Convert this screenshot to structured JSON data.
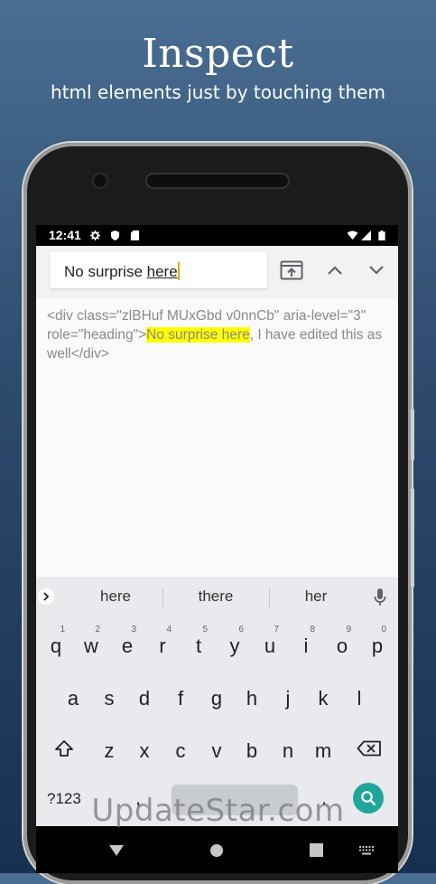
{
  "header": {
    "title": "Inspect",
    "subtitle": "html elements just by touching them"
  },
  "status_bar": {
    "time": "12:41"
  },
  "toolbar": {
    "search_value_plain": "No surprise ",
    "search_value_underlined": "here"
  },
  "content": {
    "html_before": "<div class=\"zlBHuf MUxGbd v0nnCb\" aria-level=\"3\" role=\"heading\">",
    "highlighted": "No surprise here",
    "html_after": ", I have edited this as well</div>",
    "highlight_color": "#ffff00"
  },
  "keyboard": {
    "suggestions": [
      "here",
      "there",
      "her"
    ],
    "row1": [
      {
        "key": "q",
        "hint": "1"
      },
      {
        "key": "w",
        "hint": "2"
      },
      {
        "key": "e",
        "hint": "3"
      },
      {
        "key": "r",
        "hint": "4"
      },
      {
        "key": "t",
        "hint": "5"
      },
      {
        "key": "y",
        "hint": "6"
      },
      {
        "key": "u",
        "hint": "7"
      },
      {
        "key": "i",
        "hint": "8"
      },
      {
        "key": "o",
        "hint": "9"
      },
      {
        "key": "p",
        "hint": "0"
      }
    ],
    "row2": [
      "a",
      "s",
      "d",
      "f",
      "g",
      "h",
      "j",
      "k",
      "l"
    ],
    "row3": [
      "z",
      "x",
      "c",
      "v",
      "b",
      "n",
      "m"
    ],
    "symbols_label": "?123",
    "comma": ",",
    "period": ".",
    "accent_color": "#1fa59a"
  },
  "watermark": "UpdateStar.com"
}
